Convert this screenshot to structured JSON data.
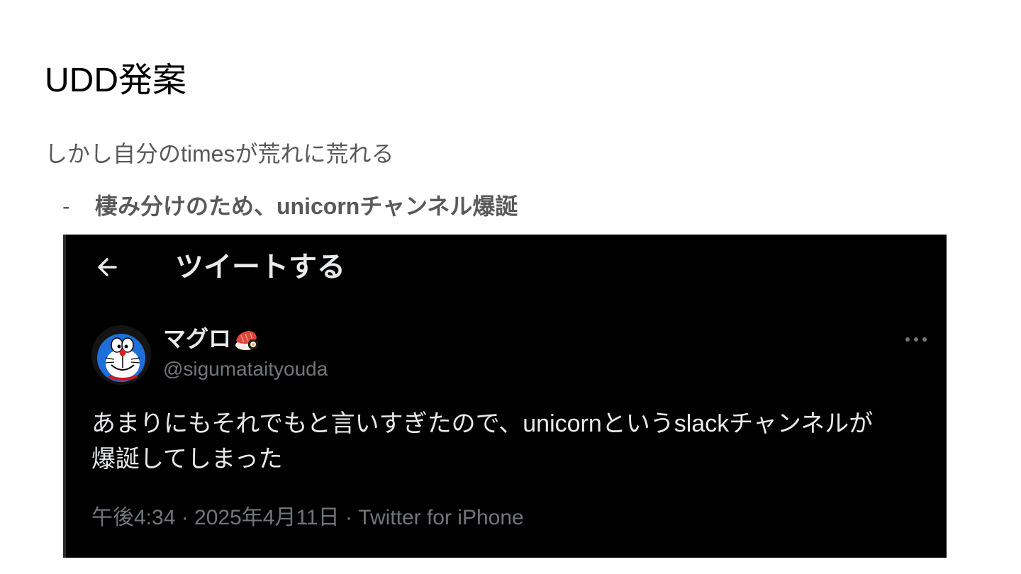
{
  "slide": {
    "title": "UDD発案",
    "body": "しかし自分のtimesが荒れに荒れる",
    "bullet": {
      "marker": "-",
      "text": "棲み分けのため、unicornチャンネル爆誕"
    }
  },
  "tweet": {
    "header_title": "ツイートする",
    "back_icon": "arrow-left-icon",
    "author": {
      "name": "マグロ",
      "name_emoji": "sushi-emoji",
      "handle": "@sigumataityouda",
      "avatar": "doraemon-avatar"
    },
    "more_icon": "more-horizontal-icon",
    "body_lines": [
      "あまりにもそれでもと言いすぎたので、unicornというslackチャンネルが",
      "爆誕してしまった"
    ],
    "meta": "午後4:34 · 2025年4月11日 · Twitter for iPhone",
    "colors": {
      "background": "#000000",
      "text": "#e7e9ea",
      "secondary": "#71767b"
    }
  }
}
